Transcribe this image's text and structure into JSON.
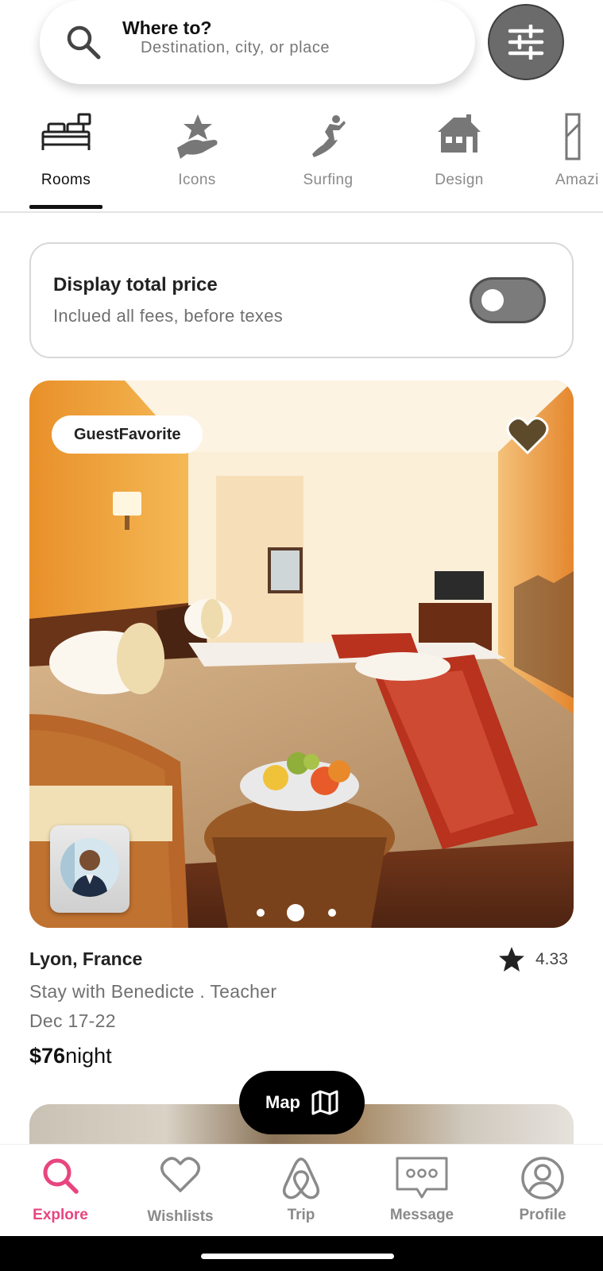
{
  "search": {
    "title": "Where to?",
    "placeholder": "Destination, city, or place",
    "icon": "search-icon",
    "filter_icon": "sliders-icon"
  },
  "categories": [
    {
      "label": "Rooms",
      "icon": "bed-icon",
      "active": true
    },
    {
      "label": "Icons",
      "icon": "hand-star-icon",
      "active": false
    },
    {
      "label": "Surfing",
      "icon": "surfer-icon",
      "active": false
    },
    {
      "label": "Design",
      "icon": "house-icon",
      "active": false
    },
    {
      "label": "Amazi",
      "icon": "building-icon",
      "active": false
    }
  ],
  "total_price": {
    "title": "Display total price",
    "subtitle": "Inclued all fees, before texes",
    "enabled": false
  },
  "listing": {
    "badge": "GuestFavorite",
    "location": "Lyon, France",
    "rating": "4.33",
    "host_line": "Stay with Benedicte . Teacher",
    "dates": "Dec 17-22",
    "price_amount": "$76",
    "price_unit": "night",
    "image_count": 3,
    "active_image": 2
  },
  "map_button": {
    "label": "Map",
    "icon": "map-icon"
  },
  "bottom_nav": [
    {
      "label": "Explore",
      "icon": "search-icon",
      "active": true
    },
    {
      "label": "Wishlists",
      "icon": "heart-icon",
      "active": false
    },
    {
      "label": "Trip",
      "icon": "airbnb-logo-icon",
      "active": false
    },
    {
      "label": "Message",
      "icon": "message-icon",
      "active": false
    },
    {
      "label": "Profile",
      "icon": "profile-icon",
      "active": false
    }
  ],
  "colors": {
    "accent": "#e8457f",
    "toggle_off": "#7b7b7b",
    "filter_button": "#6b6b6b"
  }
}
